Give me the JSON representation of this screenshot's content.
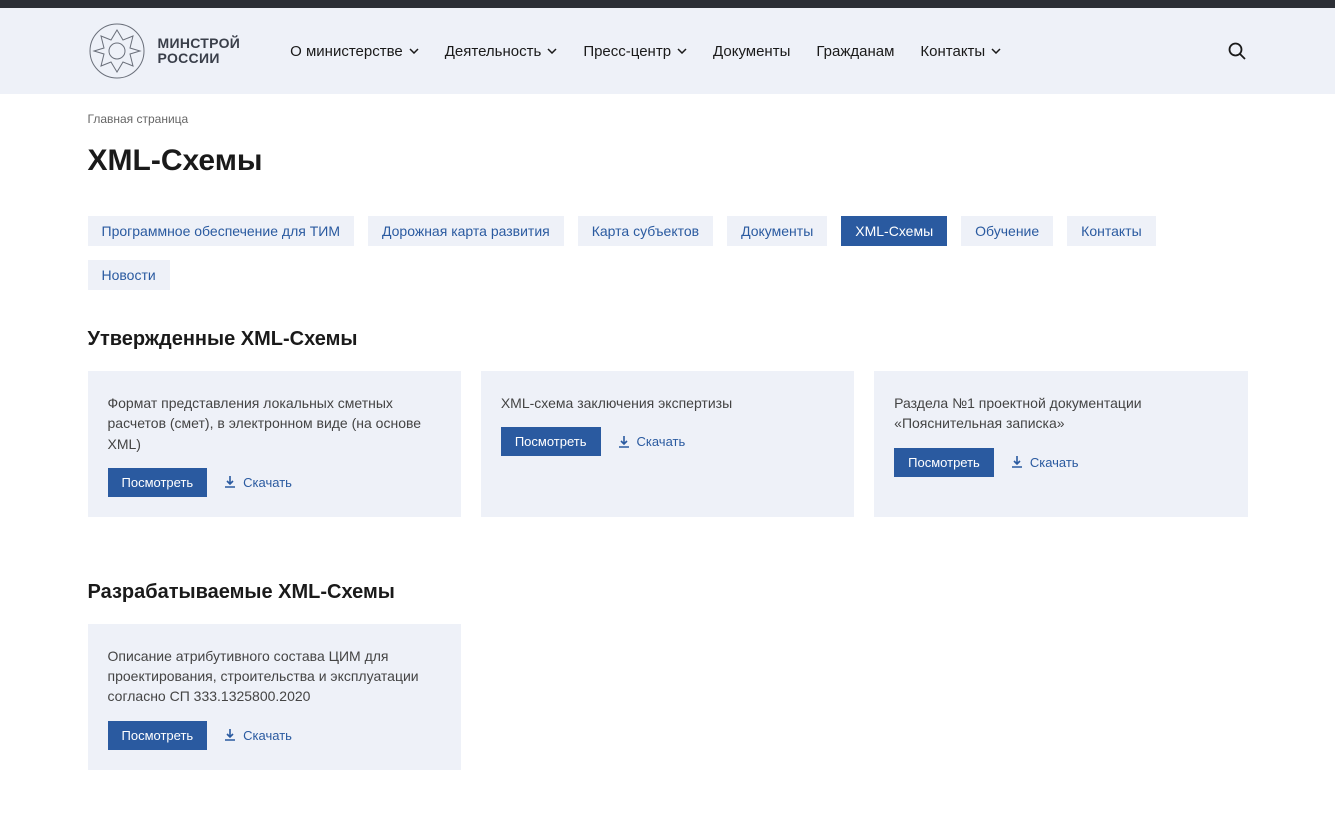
{
  "logo": {
    "line1": "МИНСТРОЙ",
    "line2": "РОССИИ"
  },
  "nav": [
    {
      "label": "О министерстве",
      "dropdown": true
    },
    {
      "label": "Деятельность",
      "dropdown": true
    },
    {
      "label": "Пресс-центр",
      "dropdown": true
    },
    {
      "label": "Документы",
      "dropdown": false
    },
    {
      "label": "Гражданам",
      "dropdown": false
    },
    {
      "label": "Контакты",
      "dropdown": true
    }
  ],
  "breadcrumb": "Главная страница",
  "page_title": "XML-Схемы",
  "tabs": [
    {
      "label": "Программное обеспечение для ТИМ",
      "active": false
    },
    {
      "label": "Дорожная карта развития",
      "active": false
    },
    {
      "label": "Карта субъектов",
      "active": false
    },
    {
      "label": "Документы",
      "active": false
    },
    {
      "label": "XML-Схемы",
      "active": true
    },
    {
      "label": "Обучение",
      "active": false
    },
    {
      "label": "Контакты",
      "active": false
    },
    {
      "label": "Новости",
      "active": false
    }
  ],
  "section1_title": "Утвержденные XML-Схемы",
  "section1_cards": [
    {
      "title": "Формат представления локальных сметных расчетов (смет), в электронном виде (на основе XML)"
    },
    {
      "title": "XML-схема заключения экспертизы"
    },
    {
      "title": "Раздела №1 проектной документации «Пояснительная записка»"
    }
  ],
  "section2_title": "Разрабатываемые XML-Схемы",
  "section2_cards": [
    {
      "title": "Описание атрибутивного состава ЦИМ для проектирования, строительства и эксплуатации согласно СП 333.1325800.2020"
    }
  ],
  "btn_view": "Посмотреть",
  "btn_download": "Скачать"
}
